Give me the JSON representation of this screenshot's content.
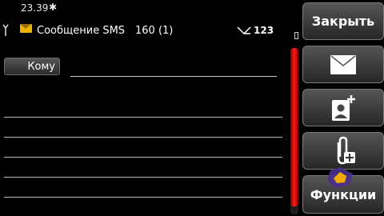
{
  "status": {
    "time": "23.39",
    "bluetooth_icon": "bluetooth-icon",
    "signal_icon": "signal-icon",
    "battery_icon": "battery-icon"
  },
  "header": {
    "title": "Сообщение SMS",
    "char_count": "160 (1)",
    "size_value": "123",
    "envelope_icon": "envelope-icon",
    "send_icon": "send-icon"
  },
  "recipient": {
    "label": "Кому",
    "value": ""
  },
  "toolbar": {
    "close_label": "Закрыть",
    "functions_label": "Функции",
    "mail_icon": "mail-icon",
    "add_contact_icon": "add-contact-icon",
    "attach_icon": "attach-icon"
  },
  "colors": {
    "accent_red": "#ff1a1a",
    "envelope_yellow": "#f0b400",
    "background": "#000000"
  }
}
